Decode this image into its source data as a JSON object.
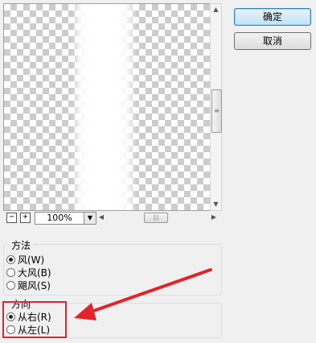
{
  "buttons": {
    "ok": "确定",
    "cancel": "取消"
  },
  "zoom": {
    "value": "100%",
    "minus": "−",
    "plus": "+"
  },
  "method_group": {
    "title": "方法",
    "options": [
      "风(W)",
      "大风(B)",
      "飓风(S)"
    ],
    "selected": 0
  },
  "direction_group": {
    "title": "方向",
    "options": [
      "从右(R)",
      "从左(L)"
    ],
    "selected": 0
  },
  "colors": {
    "highlight": "#e0242a",
    "arrow": "#e0242a"
  }
}
